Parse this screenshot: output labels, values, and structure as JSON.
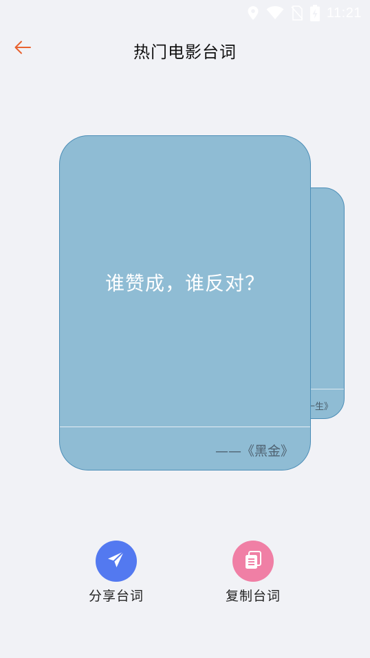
{
  "status_bar": {
    "time": "11:21",
    "icons": [
      "location-icon",
      "wifi-icon",
      "no-sim-icon",
      "battery-charging-icon"
    ]
  },
  "header": {
    "title": "热门电影台词",
    "back_icon": "arrow-left-icon"
  },
  "cards": {
    "front": {
      "quote": "谁赞成，谁反对？",
      "source": "——《黑金》"
    },
    "back": {
      "source": "一生》"
    }
  },
  "actions": {
    "share": {
      "label": "分享台词",
      "icon": "paper-plane-icon",
      "color": "#5379f0"
    },
    "copy": {
      "label": "复制台词",
      "icon": "copy-icon",
      "color": "#f07fa5"
    }
  },
  "colors": {
    "accent": "#e8622f",
    "card": "#8fbcd4",
    "background": "#f1f2f6"
  }
}
